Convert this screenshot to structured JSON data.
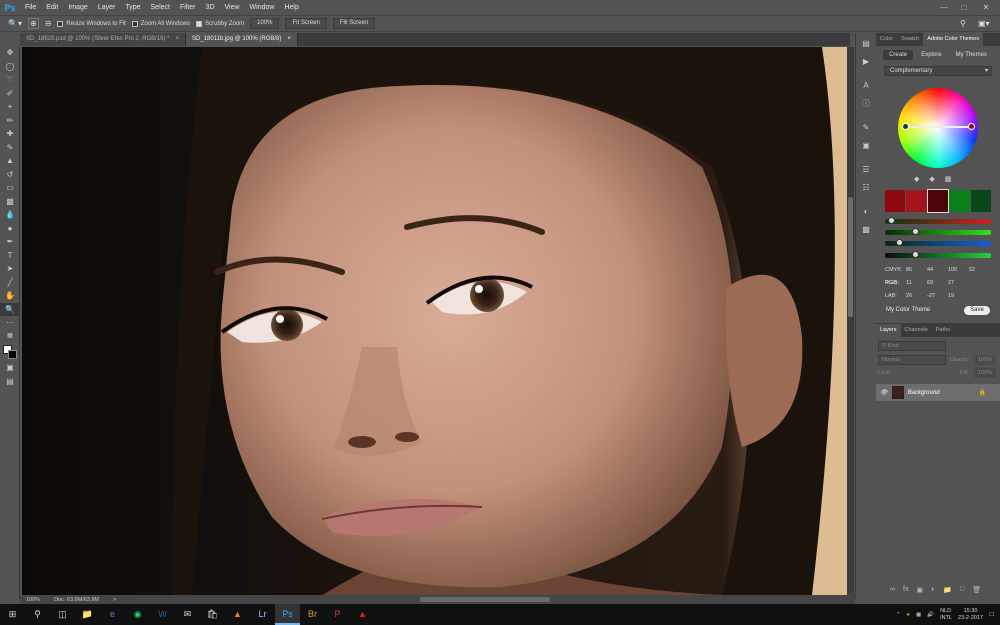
{
  "app": {
    "logo": "Ps"
  },
  "menu": [
    "File",
    "Edit",
    "Image",
    "Layer",
    "Type",
    "Select",
    "Filter",
    "3D",
    "View",
    "Window",
    "Help"
  ],
  "window_controls": [
    "—",
    "□",
    "✕"
  ],
  "options_bar": {
    "resize_windows": "Resize Windows to Fit",
    "zoom_all": "Zoom All Windows",
    "scrubby_zoom": "Scrubby Zoom",
    "zoom_value": "100%",
    "fit_screen": "Fit Screen",
    "fill_screen": "Fill Screen"
  },
  "doc_tabs": [
    {
      "label": "SD_18529.psd @ 100% (Silver Efex Pro 2, RGB/16) *",
      "close": "×"
    },
    {
      "label": "SD_18011b.jpg @ 100% (RGB/8)",
      "close": "×"
    }
  ],
  "status": {
    "zoom": "100%",
    "doc": "Doc: 63,9M/63,9M",
    "arrow": ">"
  },
  "color_panel": {
    "tabs": [
      "Color",
      "Swatch",
      "Adobe Color Themes"
    ],
    "subtabs": [
      "Create",
      "Explore",
      "My Themes"
    ],
    "mode": "Complementary",
    "swatch_colors": [
      "#8c0b10",
      "#a3141b",
      "#4a040a",
      "#0b7d1b",
      "#0b451b"
    ],
    "cmyk_label": "CMYK:",
    "cmyk": [
      "86",
      "44",
      "100",
      "52"
    ],
    "rgb_label": "RGB:",
    "rgb": [
      "11",
      "69",
      "27"
    ],
    "lab_label": "LAB:",
    "lab": [
      "26",
      "-27",
      "19"
    ],
    "theme_name": "My Color Theme",
    "save": "Save"
  },
  "layers_panel": {
    "tabs": [
      "Layers",
      "Channels",
      "Paths"
    ],
    "kind": "Kind",
    "blend": "Normal",
    "opacity_label": "Opacity:",
    "opacity": "100%",
    "lock_label": "Lock:",
    "fill_label": "Fill:",
    "fill": "100%",
    "layer_name": "Background"
  },
  "taskbar": {
    "language": "NLD",
    "layout": "INTL",
    "time": "15:30",
    "date": "23-2-2017"
  }
}
